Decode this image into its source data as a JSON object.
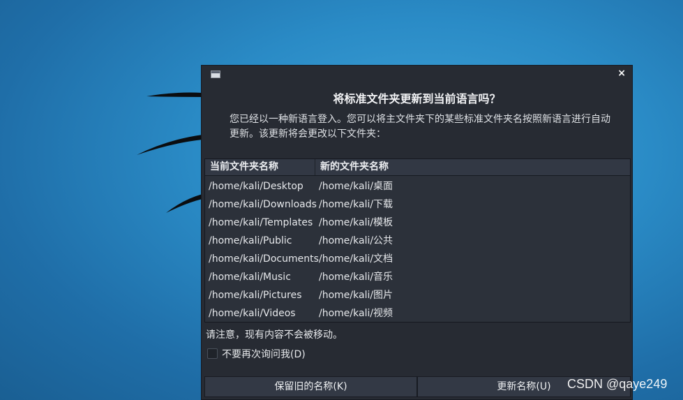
{
  "dialog": {
    "heading": "将标准文件夹更新到当前语言吗？",
    "description": "您已经以一种新语言登入。您可以将主文件夹下的某些标准文件夹名按照新语言进行自动更新。该更新将会更改以下文件夹：",
    "close_symbol": "×",
    "table": {
      "headers": [
        "当前文件夹名称",
        "新的文件夹名称"
      ],
      "rows": [
        [
          "/home/kali/Desktop",
          "/home/kali/桌面"
        ],
        [
          "/home/kali/Downloads",
          "/home/kali/下载"
        ],
        [
          "/home/kali/Templates",
          "/home/kali/模板"
        ],
        [
          "/home/kali/Public",
          "/home/kali/公共"
        ],
        [
          "/home/kali/Documents",
          "/home/kali/文档"
        ],
        [
          "/home/kali/Music",
          "/home/kali/音乐"
        ],
        [
          "/home/kali/Pictures",
          "/home/kali/图片"
        ],
        [
          "/home/kali/Videos",
          "/home/kali/视频"
        ]
      ]
    },
    "note": "请注意，现有内容不会被移动。",
    "checkbox": {
      "label": "不要再次询问我(D)",
      "checked": false
    },
    "buttons": {
      "keep": "保留旧的名称(K)",
      "update": "更新名称(U)"
    }
  },
  "watermark": "CSDN @qaye249",
  "colors": {
    "desktop": "#2a8bc6",
    "dialog_bg": "#272b33",
    "table_bg": "#2c313a"
  }
}
